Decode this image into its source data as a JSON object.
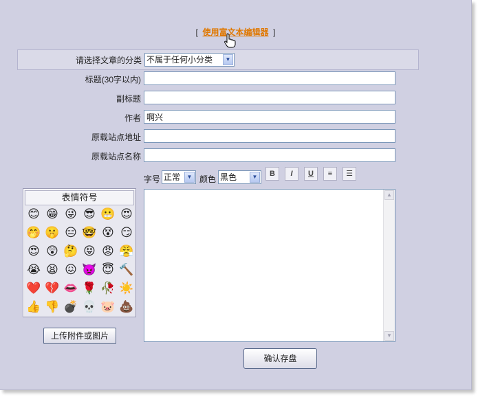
{
  "rich_editor": {
    "bracket_left": "[",
    "link": "使用富文本编辑器",
    "bracket_right": "]"
  },
  "category": {
    "label": "请选择文章的分类",
    "selected": "不属于任何小分类"
  },
  "fields": {
    "title": {
      "label": "标题(30字以内)",
      "value": ""
    },
    "subtitle": {
      "label": "副标题",
      "value": ""
    },
    "author": {
      "label": "作者",
      "value": "啊兴"
    },
    "source_url": {
      "label": "原载站点地址",
      "value": ""
    },
    "source_name": {
      "label": "原载站点名称",
      "value": ""
    }
  },
  "toolbar": {
    "font_size_label": "字号",
    "font_size_value": "正常",
    "color_label": "颜色",
    "color_value": "黑色",
    "bold": "B",
    "italic": "I",
    "underline": "U",
    "center": "≡",
    "list": "☰"
  },
  "emoji_panel": {
    "title": "表情符号",
    "rows": [
      [
        "😊",
        "😁",
        "😜",
        "😎",
        "😬",
        "😍"
      ],
      [
        "🤭",
        "🤫",
        "😑",
        "🤓",
        "😵",
        "😏"
      ],
      [
        "😍",
        "😲",
        "🤔",
        "😝",
        "😡",
        "😤"
      ],
      [
        "😭",
        "😫",
        "😖",
        "👿",
        "😇",
        "🔨"
      ],
      [
        "❤️",
        "💔",
        "👄",
        "🌹",
        "🥀",
        "☀️"
      ],
      [
        "👍",
        "👎",
        "💣",
        "💀",
        "🐷",
        "💩"
      ]
    ]
  },
  "upload_button": "上传附件或图片",
  "save_button": "确认存盘",
  "colors": {
    "background": "#d0d0e2",
    "link": "#e07800",
    "border": "#7a96b8"
  },
  "icons": {
    "cursor": "hand-pointer-icon",
    "dropdown": "chevron-down-icon"
  }
}
